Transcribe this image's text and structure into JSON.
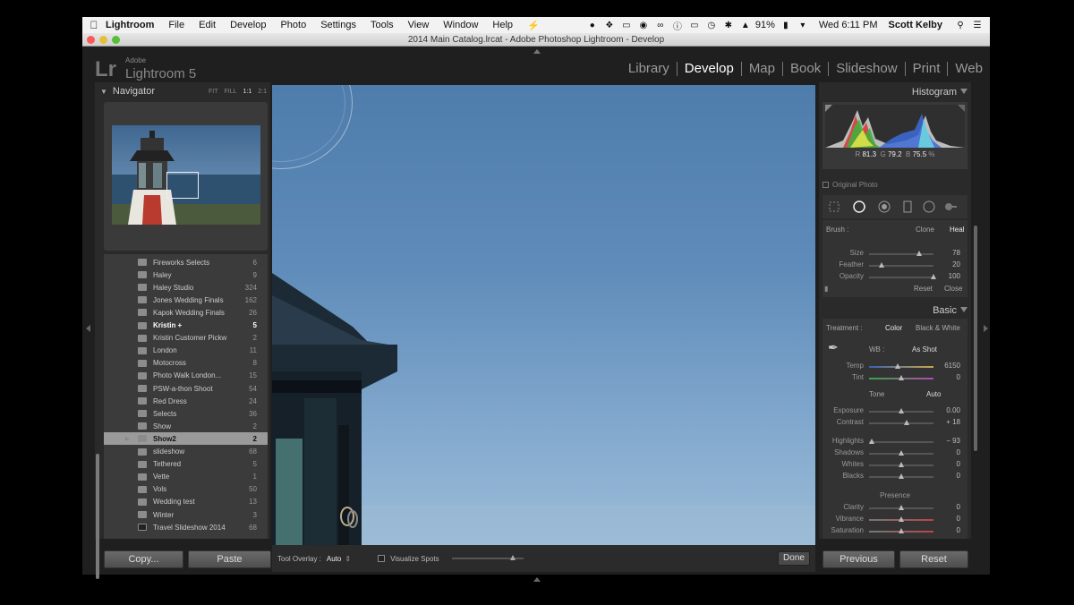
{
  "menubar": {
    "items": [
      "Lightroom",
      "File",
      "Edit",
      "Develop",
      "Photo",
      "Settings",
      "Tools",
      "View",
      "Window",
      "Help"
    ],
    "battery": "91%",
    "clock": "Wed 6:11 PM",
    "user": "Scott Kelby"
  },
  "window": {
    "title": "2014 Main Catalog.lrcat - Adobe Photoshop Lightroom - Develop"
  },
  "identity": {
    "logo": "Lr",
    "adobe": "Adobe",
    "product": "Lightroom 5"
  },
  "modules": [
    "Library",
    "Develop",
    "Map",
    "Book",
    "Slideshow",
    "Print",
    "Web"
  ],
  "navigator": {
    "title": "Navigator",
    "zooms": [
      "FIT",
      "FILL",
      "1:1",
      "2:1"
    ]
  },
  "folders": [
    {
      "name": "Fireworks Selects",
      "count": "6"
    },
    {
      "name": "Haley",
      "count": "9"
    },
    {
      "name": "Haley Studio",
      "count": "324"
    },
    {
      "name": "Jones Wedding Finals",
      "count": "162"
    },
    {
      "name": "Kapok Wedding Finals",
      "count": "26"
    },
    {
      "name": "Kristin  +",
      "count": "5"
    },
    {
      "name": "Kristin Customer Pickw",
      "count": "2"
    },
    {
      "name": "London",
      "count": "11"
    },
    {
      "name": "Motocross",
      "count": "8"
    },
    {
      "name": "Photo Walk London...",
      "count": "15"
    },
    {
      "name": "PSW-a-thon Shoot",
      "count": "54"
    },
    {
      "name": "Red Dress",
      "count": "24"
    },
    {
      "name": "Selects",
      "count": "36"
    },
    {
      "name": "Show",
      "count": "2"
    },
    {
      "name": "Show2",
      "count": "2"
    },
    {
      "name": "slideshow",
      "count": "68"
    },
    {
      "name": "Tethered",
      "count": "5"
    },
    {
      "name": "Vette",
      "count": "1"
    },
    {
      "name": "Vols",
      "count": "50"
    },
    {
      "name": "Wedding test",
      "count": "13"
    },
    {
      "name": "Winter",
      "count": "3"
    },
    {
      "name": "Travel Slideshow 2014",
      "count": "68"
    }
  ],
  "left_buttons": {
    "copy": "Copy...",
    "paste": "Paste"
  },
  "toolbar": {
    "overlay_label": "Tool Overlay :",
    "overlay_value": "Auto",
    "visualize_label": "Visualize Spots",
    "visualize_level": 0.85,
    "done": "Done"
  },
  "histogram": {
    "title": "Histogram",
    "r_label": "R",
    "r": "81.3",
    "g_label": "G",
    "g": "79.2",
    "b_label": "B",
    "b": "75.5",
    "unit": "%",
    "original_photo": "Original Photo"
  },
  "brush": {
    "label": "Brush :",
    "clone": "Clone",
    "heal": "Heal",
    "sliders": [
      {
        "label": "Size",
        "value": "78",
        "level": 0.78
      },
      {
        "label": "Feather",
        "value": "20",
        "level": 0.2
      },
      {
        "label": "Opacity",
        "value": "100",
        "level": 1.0
      }
    ],
    "reset": "Reset",
    "close": "Close"
  },
  "basic": {
    "title": "Basic",
    "treatment_label": "Treatment :",
    "color": "Color",
    "bw": "Black & White",
    "wb_label": "WB :",
    "wb_value": "As Shot",
    "wb_sliders": [
      {
        "label": "Temp",
        "value": "6150",
        "level": 0.45
      },
      {
        "label": "Tint",
        "value": "0",
        "level": 0.5
      }
    ],
    "tone_label": "Tone",
    "auto": "Auto",
    "tone_sliders": [
      {
        "label": "Exposure",
        "value": "0.00",
        "level": 0.5
      },
      {
        "label": "Contrast",
        "value": "+ 18",
        "level": 0.59
      }
    ],
    "tone_sliders2": [
      {
        "label": "Highlights",
        "value": "− 93",
        "level": 0.035
      },
      {
        "label": "Shadows",
        "value": "0",
        "level": 0.5
      },
      {
        "label": "Whites",
        "value": "0",
        "level": 0.5
      },
      {
        "label": "Blacks",
        "value": "0",
        "level": 0.5
      }
    ],
    "presence_label": "Presence",
    "presence_sliders": [
      {
        "label": "Clarity",
        "value": "0",
        "level": 0.5
      },
      {
        "label": "Vibrance",
        "value": "0",
        "level": 0.5
      },
      {
        "label": "Saturation",
        "value": "0",
        "level": 0.5
      }
    ]
  },
  "right_buttons": {
    "previous": "Previous",
    "reset": "Reset"
  }
}
